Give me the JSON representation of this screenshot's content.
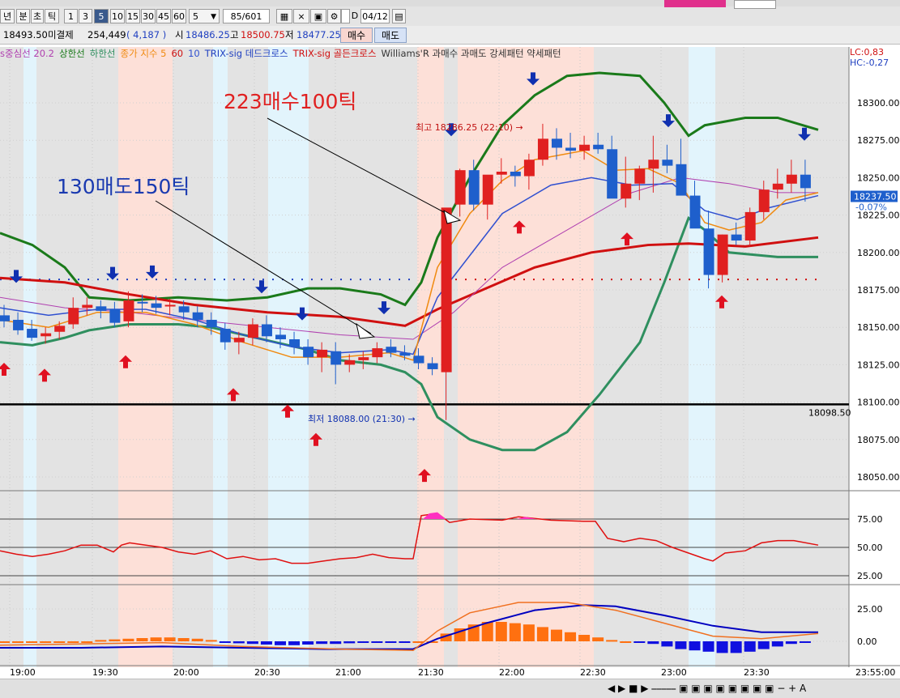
{
  "toolbar": {
    "period_buttons": [
      "년",
      "분",
      "초",
      "틱",
      "1",
      "3",
      "5",
      "10",
      "15",
      "30",
      "45",
      "60"
    ],
    "selected_index": 6,
    "interval_value": "5",
    "count_value": "85/601",
    "date_value": "04/12",
    "checkbox_label": "D"
  },
  "quote": {
    "price": "18493.50",
    "label_unsettled": "미결제",
    "unsettled": "254,449",
    "change": "( 4,187 )",
    "open_label": "시",
    "open": "18486.25",
    "high_label": "고",
    "high": "18500.75",
    "low_label": "저",
    "low": "18477.25",
    "buy_label": "매수",
    "sell_label": "매도"
  },
  "legend": {
    "items": [
      {
        "text": "s중심선 20.2",
        "color": "#b040b0"
      },
      {
        "text": "상한선",
        "color": "#1a7a1a"
      },
      {
        "text": "하한선",
        "color": "#2f8f5f"
      },
      {
        "text": "종가 지수 5",
        "color": "#f08a10"
      },
      {
        "text": "60",
        "color": "#d01010"
      },
      {
        "text": "10",
        "color": "#3050d0"
      },
      {
        "text": "TRIX-sig 데드크로스",
        "color": "#2040c0"
      },
      {
        "text": "TRIX-sig 골든크로스",
        "color": "#d01010"
      },
      {
        "text": "Williams'R 과매수 과매도 강세패턴  약세패턴",
        "color": "#333333"
      }
    ],
    "lc": "LC:0,83",
    "hc": "HC:-0,27"
  },
  "annotations": {
    "buy_note": "223매수100틱",
    "sell_note": "130매도150틱",
    "high_note": "최고 18286.25 (22:10)",
    "low_note": "최저 18088.00 (21:30)",
    "line_value": "18098.50",
    "current_price": "18237.50",
    "current_change": "-0.07%"
  },
  "colors": {
    "up": "#e02020",
    "down": "#1e5fcc",
    "band_pink": "#fde0d8",
    "band_blue": "#e2f4fc",
    "band_gray": "#e3e3e3"
  },
  "chart_data": {
    "type": "candlestick",
    "price_axis_ticks": [
      "18300.00",
      "18275.00",
      "18250.00",
      "18225.00",
      "18200.00",
      "18175.00",
      "18150.00",
      "18125.00",
      "18100.00",
      "18075.00",
      "18050.00"
    ],
    "osc_axis_ticks": [
      "75.00",
      "50.00",
      "25.00"
    ],
    "trix_axis_ticks": [
      "25.00",
      "0.00"
    ],
    "time_labels": [
      "19:00",
      "19:30",
      "20:00",
      "20:30",
      "21:00",
      "21:30",
      "22:00",
      "22:30",
      "23:00",
      "23:30",
      "23:55:00"
    ],
    "candles": [
      [
        18158,
        18165,
        18150,
        18154
      ],
      [
        18155,
        18160,
        18145,
        18148
      ],
      [
        18149,
        18155,
        18141,
        18143
      ],
      [
        18144,
        18150,
        18139,
        18146
      ],
      [
        18147,
        18154,
        18142,
        18151
      ],
      [
        18152,
        18170,
        18149,
        18163
      ],
      [
        18163,
        18170,
        18158,
        18165
      ],
      [
        18164,
        18168,
        18156,
        18161
      ],
      [
        18162,
        18167,
        18150,
        18153
      ],
      [
        18154,
        18174,
        18150,
        18168
      ],
      [
        18167,
        18172,
        18160,
        18166
      ],
      [
        18166,
        18171,
        18159,
        18163
      ],
      [
        18164,
        18169,
        18158,
        18165
      ],
      [
        18164,
        18168,
        18155,
        18160
      ],
      [
        18160,
        18164,
        18150,
        18155
      ],
      [
        18155,
        18160,
        18145,
        18150
      ],
      [
        18149,
        18153,
        18135,
        18140
      ],
      [
        18140,
        18147,
        18132,
        18143
      ],
      [
        18143,
        18156,
        18138,
        18152
      ],
      [
        18152,
        18158,
        18140,
        18144
      ],
      [
        18145,
        18150,
        18136,
        18142
      ],
      [
        18142,
        18147,
        18132,
        18137
      ],
      [
        18137,
        18142,
        18125,
        18130
      ],
      [
        18130,
        18140,
        18120,
        18135
      ],
      [
        18134,
        18140,
        18112,
        18125
      ],
      [
        18125,
        18132,
        18120,
        18128
      ],
      [
        18128,
        18134,
        18122,
        18130
      ],
      [
        18130,
        18140,
        18126,
        18136
      ],
      [
        18137,
        18142,
        18130,
        18133
      ],
      [
        18133,
        18138,
        18128,
        18131
      ],
      [
        18131,
        18136,
        18122,
        18126
      ],
      [
        18126,
        18130,
        18118,
        18122
      ],
      [
        18120,
        18148,
        18088,
        18230
      ],
      [
        18232,
        18256,
        18224,
        18255
      ],
      [
        18255,
        18262,
        18228,
        18232
      ],
      [
        18232,
        18246,
        18222,
        18252
      ],
      [
        18252,
        18263,
        18246,
        18254
      ],
      [
        18254,
        18258,
        18244,
        18251
      ],
      [
        18251,
        18266,
        18242,
        18262
      ],
      [
        18262,
        18286,
        18258,
        18276
      ],
      [
        18276,
        18283,
        18262,
        18270
      ],
      [
        18270,
        18280,
        18263,
        18268
      ],
      [
        18268,
        18278,
        18262,
        18272
      ],
      [
        18272,
        18280,
        18266,
        18269
      ],
      [
        18269,
        18278,
        18255,
        18236
      ],
      [
        18236,
        18264,
        18230,
        18246
      ],
      [
        18246,
        18258,
        18235,
        18256
      ],
      [
        18256,
        18278,
        18240,
        18262
      ],
      [
        18262,
        18272,
        18253,
        18258
      ],
      [
        18259,
        18276,
        18240,
        18238
      ],
      [
        18238,
        18248,
        18220,
        18216
      ],
      [
        18216,
        18228,
        18176,
        18185
      ],
      [
        18185,
        18212,
        18180,
        18212
      ],
      [
        18212,
        18220,
        18205,
        18208
      ],
      [
        18208,
        18230,
        18204,
        18227
      ],
      [
        18227,
        18248,
        18222,
        18242
      ],
      [
        18242,
        18256,
        18236,
        18246
      ],
      [
        18246,
        18262,
        18240,
        18252
      ],
      [
        18252,
        18262,
        18234,
        18243
      ]
    ]
  }
}
